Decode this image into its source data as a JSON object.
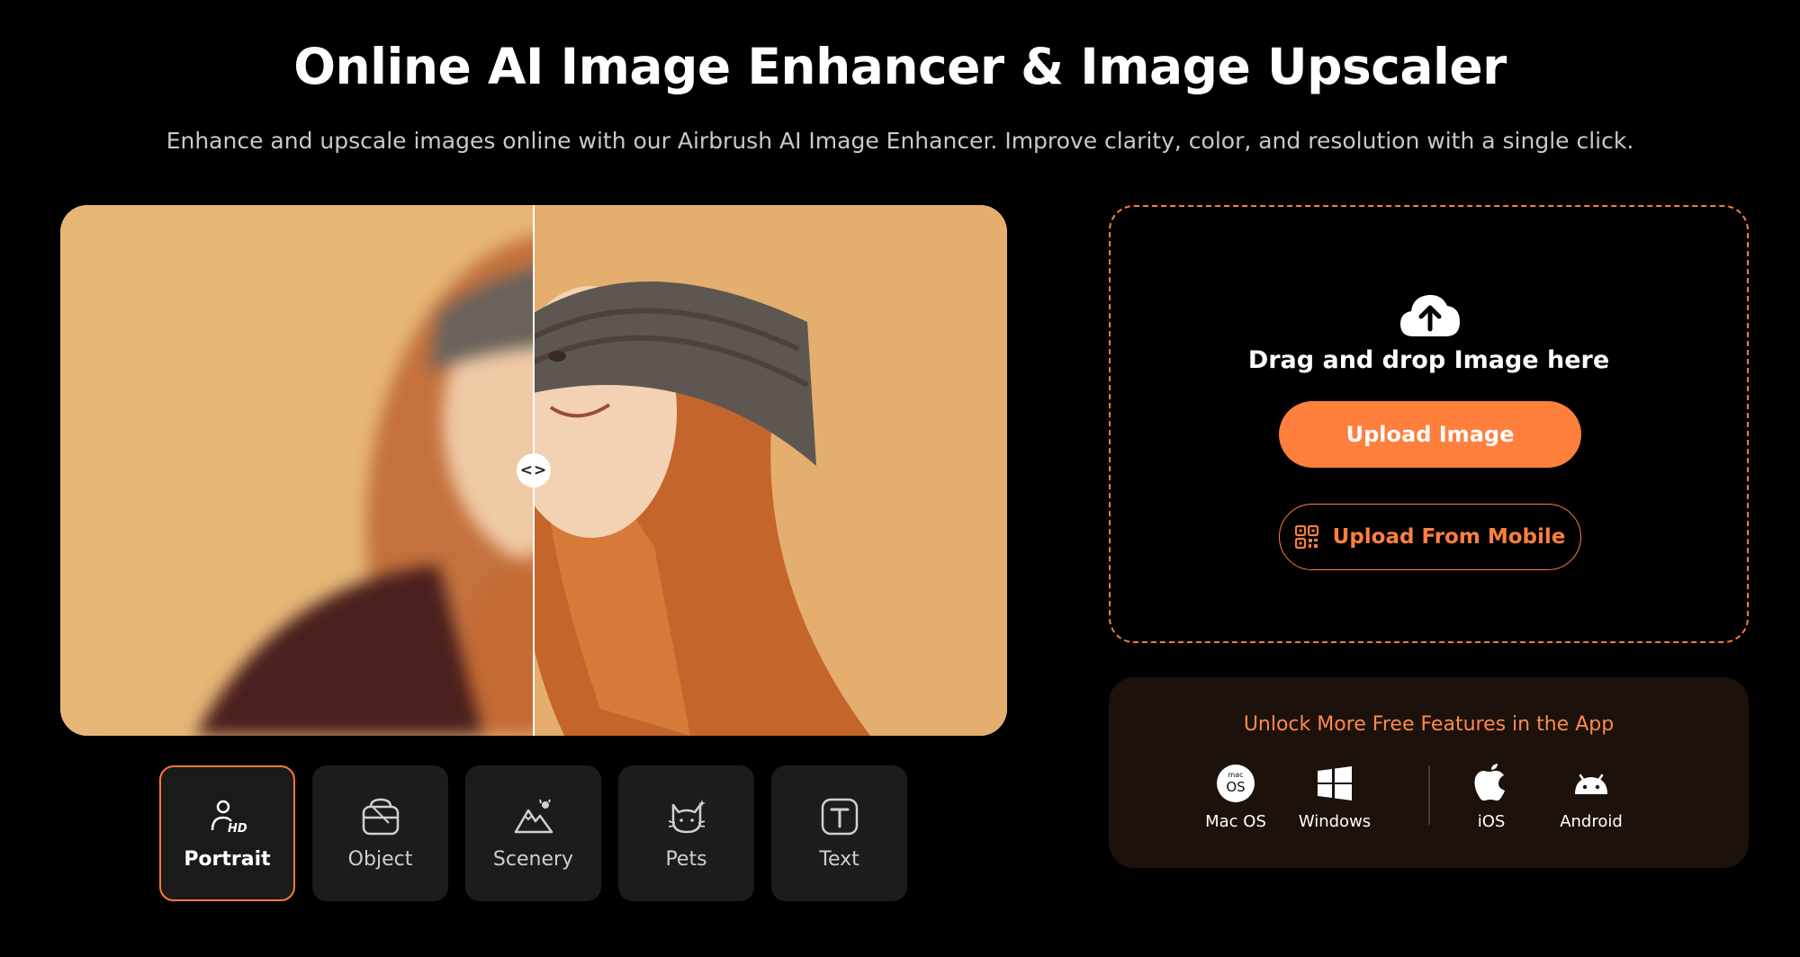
{
  "header": {
    "title": "Online AI Image Enhancer & Image Upscaler",
    "subtitle": "Enhance and upscale images online with our Airbrush AI Image Enhancer. Improve clarity, color, and resolution with a single click."
  },
  "compare": {
    "handle_glyph": "<>",
    "split_fraction": 0.5
  },
  "tabs": [
    {
      "label": "Portrait",
      "icon": "portrait-hd-icon",
      "active": true
    },
    {
      "label": "Object",
      "icon": "object-bag-icon",
      "active": false
    },
    {
      "label": "Scenery",
      "icon": "scenery-mountain-icon",
      "active": false
    },
    {
      "label": "Pets",
      "icon": "pets-cat-icon",
      "active": false
    },
    {
      "label": "Text",
      "icon": "text-t-icon",
      "active": false
    }
  ],
  "upload": {
    "drag_text": "Drag and drop Image here",
    "upload_button": "Upload Image",
    "mobile_button": "Upload From Mobile"
  },
  "app_promo": {
    "title": "Unlock More Free Features in the App",
    "platforms": [
      {
        "label": "Mac OS",
        "icon": "macos-icon",
        "icon_text": "mac OS"
      },
      {
        "label": "Windows",
        "icon": "windows-icon"
      },
      {
        "label": "iOS",
        "icon": "apple-icon"
      },
      {
        "label": "Android",
        "icon": "android-icon"
      }
    ]
  },
  "colors": {
    "accent": "#ff7f3d",
    "background": "#000000",
    "tab_bg": "#1c1c1c",
    "app_panel_bg": "#1c110b"
  }
}
